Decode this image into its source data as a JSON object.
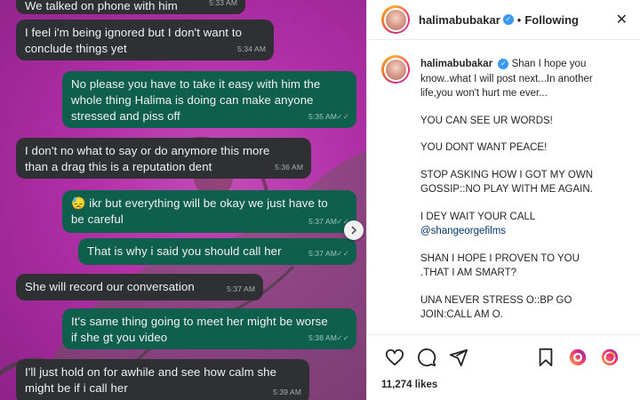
{
  "chat": {
    "messages": [
      {
        "dir": "in",
        "text": "We talked on phone with him",
        "time": "5:33 AM"
      },
      {
        "dir": "in",
        "text": "I feel i'm being ignored but I don't want to\nconclude things yet",
        "time": "5:34 AM"
      },
      {
        "dir": "out",
        "text": "No please you have to take it easy with him the\nwhole thing Halima is doing can make anyone\nstressed and piss off",
        "time": "5:35 AM"
      },
      {
        "dir": "in",
        "text": "I don't no what to say or do anymore this more\nthan a drag this is a reputation dent",
        "time": "5:36 AM"
      },
      {
        "dir": "out",
        "text": "😓 ikr but everything will be okay we just have to\nbe careful",
        "time": "5:37 AM"
      },
      {
        "dir": "out",
        "text": "That is why i said you should call her",
        "time": "5:37 AM"
      },
      {
        "dir": "in",
        "text": "She will record our conversation",
        "time": "5:37 AM"
      },
      {
        "dir": "out",
        "text": "It's same thing going to meet her might be worse\nif she gt you video",
        "time": "5:38 AM"
      },
      {
        "dir": "in",
        "text": "I'll just hold on for awhile and see how calm she\nmight be if i call her",
        "time": "5:39 AM"
      }
    ]
  },
  "post": {
    "username": "halimabubakar",
    "separator": "•",
    "follow_label": "Following",
    "more_icon": "more-options-icon",
    "caption": [
      "Shan I hope you",
      "know..what I will post next...In another",
      "life,you won't hurt me ever...",
      "",
      "YOU CAN SEE UR WORDS!",
      "",
      "YOU DONT WANT PEACE!",
      "",
      "STOP ASKING HOW I GOT MY OWN",
      "GOSSIP::NO PLAY WITH ME AGAIN.",
      "",
      "I DEY WAIT YOUR CALL",
      "@shangeorgefilms",
      "",
      "SHAN I HOPE I PROVEN TO YOU",
      ".THAT I AM SMART?",
      "",
      "UNA NEVER STRESS O::BP GO",
      "JOIN:CALL AM O."
    ],
    "likes": "11,274 likes",
    "icons": [
      "heart-icon",
      "comment-icon",
      "share-icon",
      "bookmark-icon",
      "reel-icon",
      "threads-icon"
    ],
    "colors": {
      "verified": "#3897f0",
      "chat_bg": "#b02fa6",
      "incoming": "#2e3033",
      "outgoing": "#0f5f4d"
    }
  }
}
